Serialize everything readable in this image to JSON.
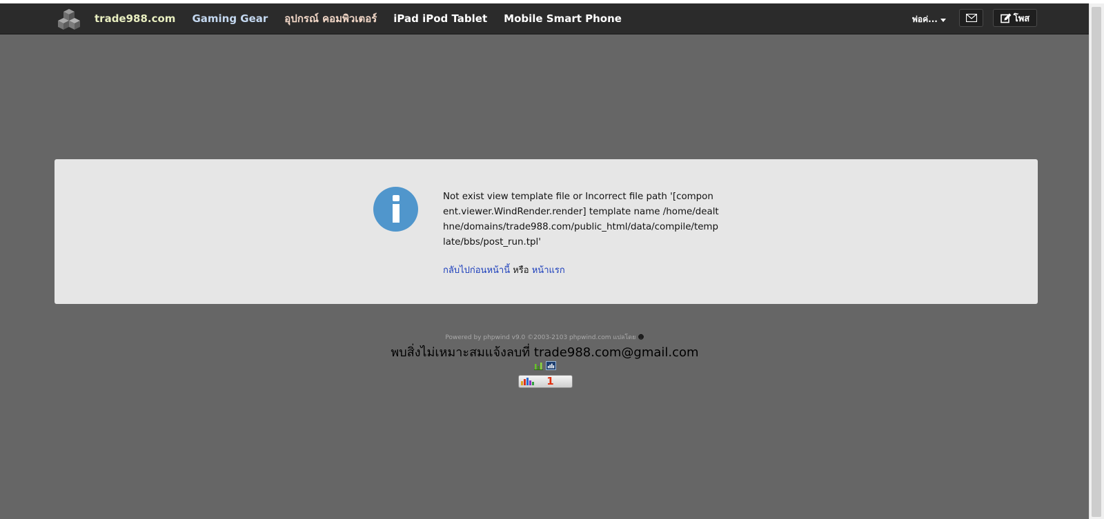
{
  "navbar": {
    "brand": "trade988.com",
    "links": [
      "Gaming Gear",
      "อุปกรณ์ คอมพิวเตอร์",
      "iPad iPod Tablet",
      "Mobile Smart Phone"
    ],
    "user_menu": "พ่อค่...",
    "mail_icon": "mail-icon",
    "post_label": "โพส",
    "post_icon": "edit-icon"
  },
  "message": {
    "icon": "info-icon",
    "text": "Not exist view template file or Incorrect file path '[component.viewer.WindRender.render] template name /home/dealthne/domains/trade988.com/public_html/data/compile/template/bbs/post_run.tpl'",
    "back_link": "กลับไปก่อนหน้านี้",
    "or": "หรือ",
    "home_link": "หน้าแรก"
  },
  "footer": {
    "powered": "Powered by phpwind v9.0 ©2003-2103 phpwind.com แปลโดย",
    "report": "พบสิ่งไม่เหมาะสมแจ้งลบที่ trade988.com@gmail.com",
    "counter": "1"
  },
  "colors": {
    "background": "#666666",
    "navbar": "#2b2b2b",
    "panel": "#e6e6e6",
    "info": "#5096cc",
    "link": "#1a3dbb",
    "counter_number": "#e03010"
  }
}
